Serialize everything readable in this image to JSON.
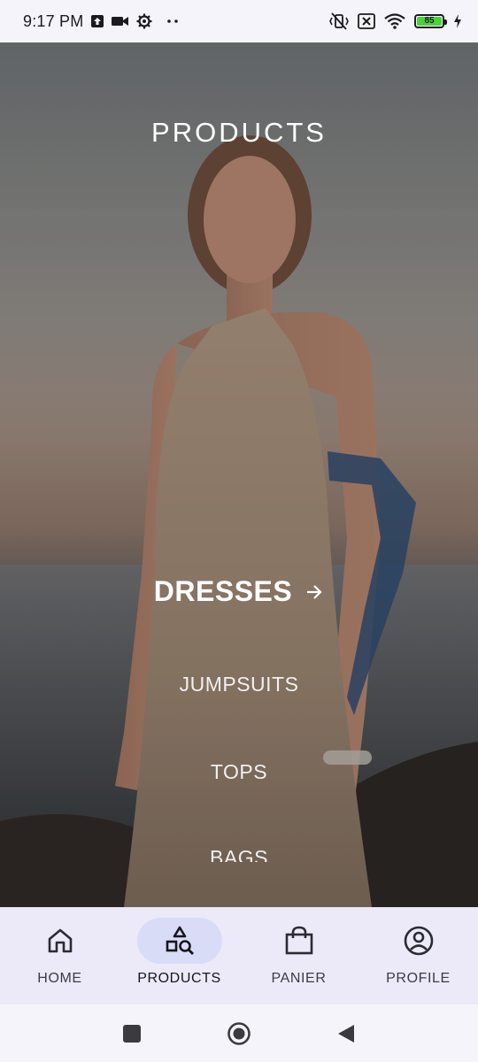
{
  "status_bar": {
    "time": "9:17 PM",
    "battery_level": "85",
    "left_icons": [
      "upload-notification-icon",
      "video-camera-icon",
      "settings-notification-icon",
      "more-notifications-icon"
    ],
    "right_icons": [
      "vibrate-off-icon",
      "sim-off-icon",
      "wifi-icon",
      "battery-icon",
      "charging-icon"
    ],
    "colors": {
      "battery_fill": "#4cd137"
    }
  },
  "page": {
    "title": "PRODUCTS"
  },
  "categories": {
    "active": "DRESSES",
    "items": [
      "JUMPSUITS",
      "TOPS",
      "BAGS"
    ]
  },
  "bottom_nav": {
    "items": [
      {
        "label": "HOME",
        "icon": "home-icon"
      },
      {
        "label": "PRODUCTS",
        "icon": "products-search-icon"
      },
      {
        "label": "PANIER",
        "icon": "shopping-bag-icon"
      },
      {
        "label": "PROFILE",
        "icon": "profile-icon"
      }
    ],
    "active": "PRODUCTS",
    "colors": {
      "background": "#eceaf8",
      "active_pill": "#d9dcf7"
    }
  },
  "system_nav": {
    "icons": [
      "recents-square-icon",
      "home-circle-icon",
      "back-triangle-icon"
    ]
  }
}
